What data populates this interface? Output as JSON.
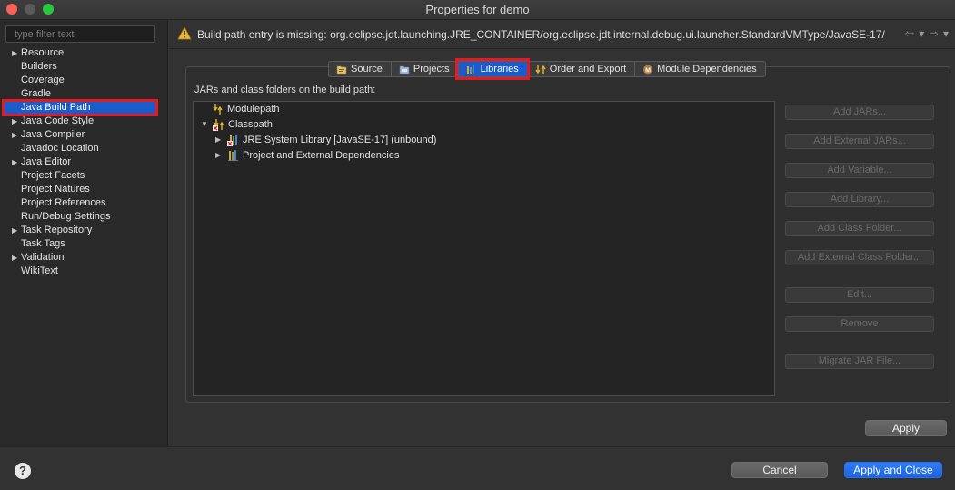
{
  "window": {
    "title": "Properties for demo"
  },
  "sidebar": {
    "filter_placeholder": "type filter text",
    "items": [
      {
        "label": "Resource",
        "expandable": true
      },
      {
        "label": "Builders",
        "expandable": false
      },
      {
        "label": "Coverage",
        "expandable": false
      },
      {
        "label": "Gradle",
        "expandable": false
      },
      {
        "label": "Java Build Path",
        "expandable": false,
        "selected": true
      },
      {
        "label": "Java Code Style",
        "expandable": true
      },
      {
        "label": "Java Compiler",
        "expandable": true
      },
      {
        "label": "Javadoc Location",
        "expandable": false
      },
      {
        "label": "Java Editor",
        "expandable": true
      },
      {
        "label": "Project Facets",
        "expandable": false
      },
      {
        "label": "Project Natures",
        "expandable": false
      },
      {
        "label": "Project References",
        "expandable": false
      },
      {
        "label": "Run/Debug Settings",
        "expandable": false
      },
      {
        "label": "Task Repository",
        "expandable": true
      },
      {
        "label": "Task Tags",
        "expandable": false
      },
      {
        "label": "Validation",
        "expandable": true
      },
      {
        "label": "WikiText",
        "expandable": false
      }
    ]
  },
  "message": {
    "text": "Build path entry is missing: org.eclipse.jdt.launching.JRE_CONTAINER/org.eclipse.jdt.internal.debug.ui.launcher.StandardVMType/JavaSE-17/",
    "nav": "⇦ ▾ ⇨ ▾"
  },
  "tabs": [
    {
      "label": "Source",
      "icon": "source-folder-icon"
    },
    {
      "label": "Projects",
      "icon": "projects-icon"
    },
    {
      "label": "Libraries",
      "icon": "libraries-icon",
      "active": true
    },
    {
      "label": "Order and Export",
      "icon": "order-export-icon"
    },
    {
      "label": "Module Dependencies",
      "icon": "module-icon"
    }
  ],
  "libraries": {
    "caption": "JARs and class folders on the build path:",
    "tree": {
      "modulepath": "Modulepath",
      "classpath": "Classpath",
      "jre": "JRE System Library [JavaSE-17] (unbound)",
      "deps": "Project and External Dependencies"
    },
    "buttons": {
      "add_jars": "Add JARs...",
      "add_external_jars": "Add External JARs...",
      "add_variable": "Add Variable...",
      "add_library": "Add Library...",
      "add_class_folder": "Add Class Folder...",
      "add_external_class_folder": "Add External Class Folder...",
      "edit": "Edit...",
      "remove": "Remove",
      "migrate_jar": "Migrate JAR File..."
    }
  },
  "actions": {
    "apply": "Apply",
    "cancel": "Cancel",
    "apply_close": "Apply and Close",
    "help": "?"
  },
  "colors": {
    "selection": "#1b5ccc",
    "highlight_outline": "#e31b23",
    "primary_button": "#2a6fe8"
  }
}
